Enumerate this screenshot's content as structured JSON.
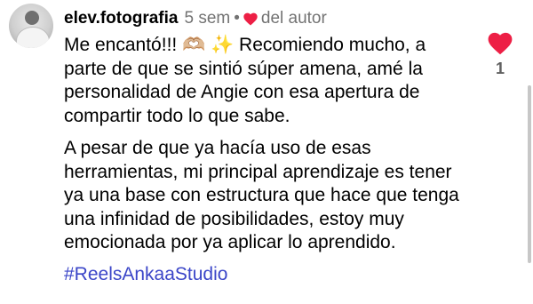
{
  "comment": {
    "username": "elev.fotografia",
    "time": "5 sem",
    "separator": "•",
    "author_badge": "del autor",
    "paragraph1": "Me encantó!!! 🫶🏼 ✨ Recomiendo mucho, a parte de que se sintió súper amena, amé la personalidad de Angie con esa apertura de compartir todo lo que sabe.",
    "paragraph2": "A pesar de que ya hacía uso de esas herramientas, mi principal aprendizaje es tener ya una base con estructura que hace que tenga una infinidad de posibilidades, estoy muy emocionada por ya aplicar lo aprendido.",
    "hashtag": "#ReelsAnkaaStudio",
    "like_count": "1"
  },
  "icons": {
    "avatar": "profile-photo",
    "small_heart": "heart-icon",
    "like": "heart-filled-icon"
  },
  "colors": {
    "heart": "#ed1f45",
    "hashtag": "#3b46c8",
    "meta_text": "#737373"
  }
}
